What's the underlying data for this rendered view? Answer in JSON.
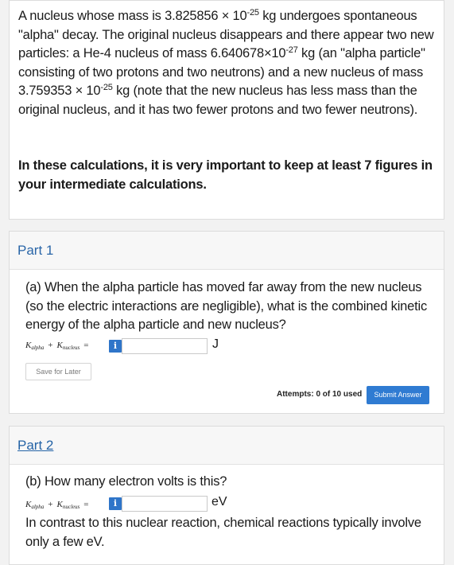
{
  "intro": {
    "s1": "A nucleus whose mass is 3.825856 × 10",
    "e1": "-25",
    "s2": " kg undergoes spontaneous \"alpha\" decay. The original nucleus disappears and there appear two new particles: a He-4 nucleus of mass 6.640678×10",
    "e2": "-27",
    "s3": " kg (an \"alpha particle\" consisting of two protons and two neutrons) and a new nucleus of mass 3.759353 × 10",
    "e3": "-25",
    "s4": " kg (note that the new nucleus has less mass than the original nucleus, and it has two fewer protons and two fewer neutrons).",
    "note": "In these calculations, it is very important to keep at least 7 figures in your intermediate calculations."
  },
  "part1": {
    "title": "Part 1",
    "question": "(a) When the alpha particle has moved far away from the new nucleus (so the electric interactions are negligible), what is the combined kinetic energy of the alpha particle and new nucleus?",
    "formula": {
      "k1": "K",
      "sub1": "alpha",
      "plus": "+",
      "k2": "K",
      "sub2": "nucleus",
      "eq": "="
    },
    "info_icon": "i",
    "input_value": "",
    "unit": "J",
    "save_label": "Save for Later",
    "attempts": "Attempts: 0 of 10 used",
    "submit_label": "Submit Answer"
  },
  "part2": {
    "title": "Part 2",
    "question": "(b) How many electron volts is this?",
    "formula": {
      "k1": "K",
      "sub1": "alpha",
      "plus": "+",
      "k2": "K",
      "sub2": "nucleus",
      "eq": "="
    },
    "info_icon": "i",
    "input_value": "",
    "unit": "eV",
    "contrast_text": "In contrast to this nuclear reaction, chemical reactions typically involve only a few eV."
  },
  "colors": {
    "accent": "#2f75c9",
    "part_title": "#2a66a8"
  }
}
